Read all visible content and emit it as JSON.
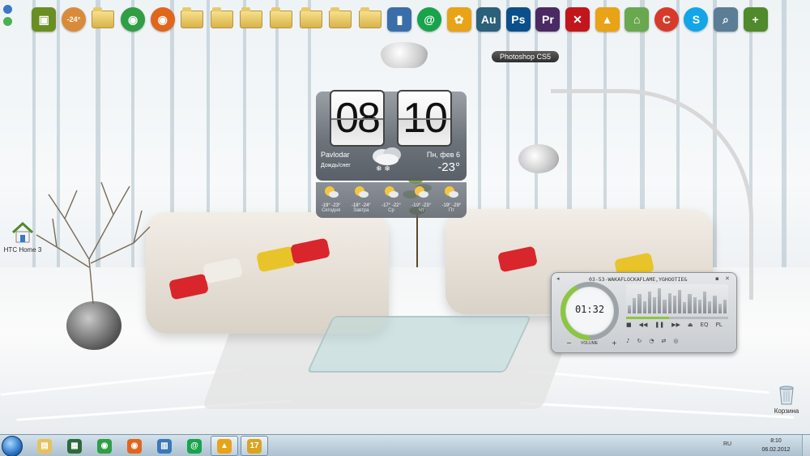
{
  "dock": {
    "items": [
      {
        "name": "cpu-gadget-icon",
        "color": "#6b8e23",
        "glyph": "▣"
      },
      {
        "name": "weather-temp-icon",
        "color": "#d98b3a",
        "glyph": "-24°"
      },
      {
        "name": "folder-network-icon",
        "color": "#e6c25b",
        "glyph": ""
      },
      {
        "name": "chrome-icon",
        "color": "#2f9e44",
        "glyph": "◉"
      },
      {
        "name": "firefox-icon",
        "color": "#e0661d",
        "glyph": "◉"
      },
      {
        "name": "folder-icon",
        "color": "#e6c25b",
        "glyph": ""
      },
      {
        "name": "folder-icon",
        "color": "#e6c25b",
        "glyph": ""
      },
      {
        "name": "folder-icon",
        "color": "#e6c25b",
        "glyph": ""
      },
      {
        "name": "folder-icon",
        "color": "#e6c25b",
        "glyph": ""
      },
      {
        "name": "folder-icon",
        "color": "#e6c25b",
        "glyph": ""
      },
      {
        "name": "folder-icon",
        "color": "#e6c25b",
        "glyph": ""
      },
      {
        "name": "folder-icon",
        "color": "#e6c25b",
        "glyph": ""
      },
      {
        "name": "books-icon",
        "color": "#3a6ea8",
        "glyph": "▮"
      },
      {
        "name": "mail-agent-icon",
        "color": "#19a34a",
        "glyph": "@"
      },
      {
        "name": "fl-studio-icon",
        "color": "#e8a317",
        "glyph": "✿"
      },
      {
        "name": "audition-icon",
        "color": "#2b5f7a",
        "glyph": "Au"
      },
      {
        "name": "photoshop-icon",
        "color": "#0b4f8a",
        "glyph": "Ps"
      },
      {
        "name": "premiere-icon",
        "color": "#4b2a63",
        "glyph": "Pr"
      },
      {
        "name": "red-app-icon",
        "color": "#c0161c",
        "glyph": "✕"
      },
      {
        "name": "aimp-icon",
        "color": "#e8a317",
        "glyph": "▲"
      },
      {
        "name": "home-icon",
        "color": "#6aa84f",
        "glyph": "⌂"
      },
      {
        "name": "ccleaner-icon",
        "color": "#d73a2b",
        "glyph": "C"
      },
      {
        "name": "skype-icon",
        "color": "#12a5e8",
        "glyph": "S"
      },
      {
        "name": "search-icon",
        "color": "#5b7d96",
        "glyph": "⌕"
      },
      {
        "name": "add-gadget-icon",
        "color": "#4f8a2b",
        "glyph": "+"
      }
    ],
    "tooltip": "Photoshop CS5"
  },
  "desktop": {
    "home_icon_label": "HTC Home 3",
    "recycle_label": "Корзина"
  },
  "clock": {
    "hours": "08",
    "minutes": "10",
    "city": "Pavlodar",
    "condition": "Дождь/снег",
    "date": "Пн, фев 6",
    "temp": "-23°"
  },
  "forecast": [
    {
      "temps": "-19° -23°",
      "name": "Сегодня"
    },
    {
      "temps": "-18° -24°",
      "name": "Завтра"
    },
    {
      "temps": "-17° -22°",
      "name": "Ср"
    },
    {
      "temps": "-19° -23°",
      "name": "Чт"
    },
    {
      "temps": "-19° -29°",
      "name": "Пт"
    }
  ],
  "player": {
    "title": "03-53-WAKAFLOCKAFLAME,YGHOOTIE&",
    "time": "01:32",
    "volume_label": "VOLUME",
    "eq_label": "EQ",
    "pl_label": "PL",
    "progress": 0.42,
    "spectrum": [
      0.3,
      0.55,
      0.7,
      0.45,
      0.8,
      0.6,
      0.9,
      0.5,
      0.75,
      0.65,
      0.85,
      0.4,
      0.7,
      0.6,
      0.5,
      0.8,
      0.45,
      0.65,
      0.35,
      0.5
    ]
  },
  "taskbar": {
    "items": [
      {
        "name": "explorer-icon",
        "color": "#e6c25b",
        "glyph": "▤"
      },
      {
        "name": "task-manager-icon",
        "color": "#2d6a3a",
        "glyph": "▦"
      },
      {
        "name": "chrome-icon",
        "color": "#2f9e44",
        "glyph": "◉"
      },
      {
        "name": "firefox-icon",
        "color": "#e0661d",
        "glyph": "◉"
      },
      {
        "name": "network-icon",
        "color": "#3a78b8",
        "glyph": "▥"
      },
      {
        "name": "mail-agent-icon",
        "color": "#19a34a",
        "glyph": "@"
      },
      {
        "name": "aimp-icon",
        "color": "#e8a317",
        "glyph": "▲"
      },
      {
        "name": "calendar-icon",
        "color": "#d9a520",
        "glyph": "17"
      }
    ],
    "lang": "RU",
    "time": "8:10",
    "date": "06.02.2012"
  }
}
